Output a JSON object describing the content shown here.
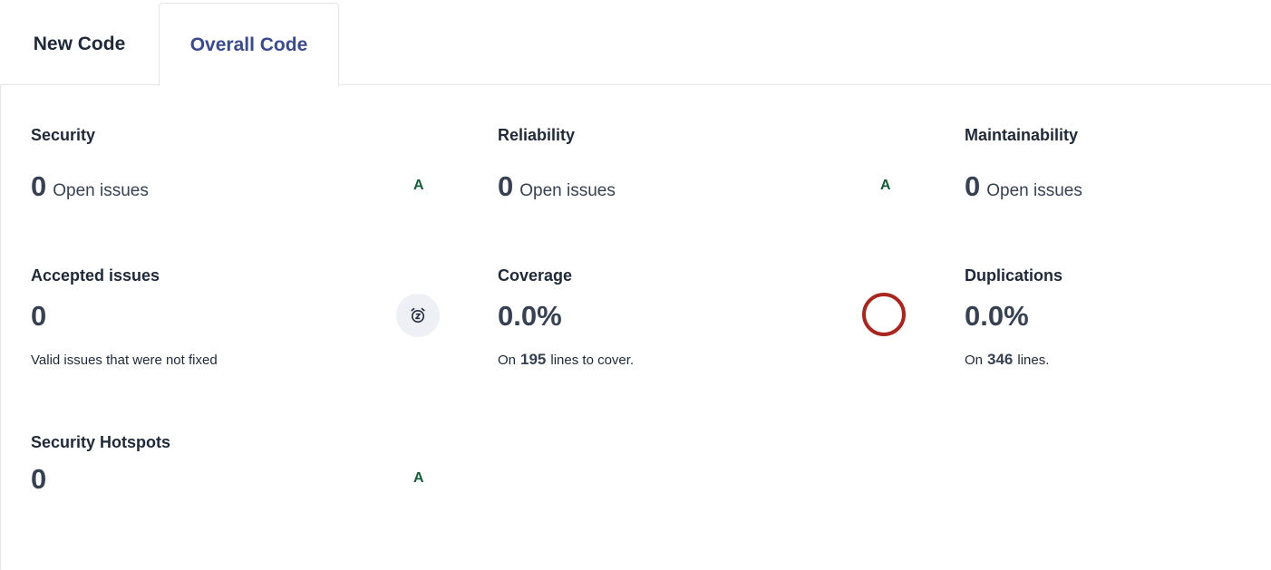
{
  "tabs": {
    "new_code": "New Code",
    "overall_code": "Overall Code"
  },
  "security": {
    "label": "Security",
    "count": "0",
    "text": "Open issues",
    "grade": "A"
  },
  "reliability": {
    "label": "Reliability",
    "count": "0",
    "text": "Open issues",
    "grade": "A"
  },
  "maintainability": {
    "label": "Maintainability",
    "count": "0",
    "text": "Open issues"
  },
  "accepted": {
    "label": "Accepted issues",
    "count": "0",
    "description": "Valid issues that were not fixed"
  },
  "coverage": {
    "label": "Coverage",
    "value": "0.0%",
    "prefix": "On",
    "lines": "195",
    "suffix": "lines to cover."
  },
  "duplications": {
    "label": "Duplications",
    "value": "0.0%",
    "prefix": "On",
    "lines": "346",
    "suffix": "lines."
  },
  "hotspots": {
    "label": "Security Hotspots",
    "count": "0",
    "grade": "A"
  },
  "colors": {
    "accent": "#3b4a8c",
    "grade_a": "#165c3a",
    "coverage_ring": "#a8261f"
  },
  "icons": {
    "accepted": "snooze-alarm-icon",
    "coverage": "coverage-ring-icon"
  }
}
